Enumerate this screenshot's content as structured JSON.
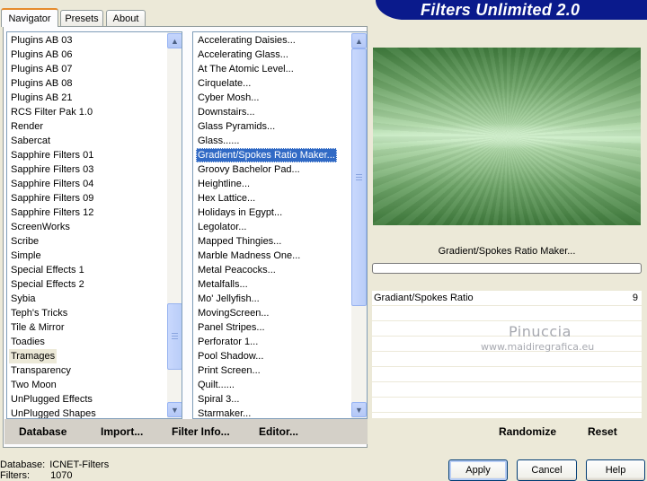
{
  "app": {
    "title": "Filters Unlimited 2.0"
  },
  "tabs": [
    {
      "label": "Navigator",
      "active": true
    },
    {
      "label": "Presets",
      "active": false
    },
    {
      "label": "About",
      "active": false
    }
  ],
  "categories": {
    "items": [
      "Plugins AB 03",
      "Plugins AB 06",
      "Plugins AB 07",
      "Plugins AB 08",
      "Plugins AB 21",
      "RCS Filter Pak 1.0",
      "Render",
      "Sabercat",
      "Sapphire Filters 01",
      "Sapphire Filters 03",
      "Sapphire Filters 04",
      "Sapphire Filters 09",
      "Sapphire Filters 12",
      "ScreenWorks",
      "Scribe",
      "Simple",
      "Special Effects 1",
      "Special Effects 2",
      "Sybia",
      "Teph's Tricks",
      "Tile & Mirror",
      "Toadies",
      "Tramages",
      "Transparency",
      "Two Moon",
      "UnPlugged Effects",
      "UnPlugged Shapes"
    ],
    "selected": "Tramages"
  },
  "filters": {
    "items": [
      "Accelerating Daisies...",
      "Accelerating Glass...",
      "At The Atomic Level...",
      "Cirquelate...",
      "Cyber Mosh...",
      "Downstairs...",
      "Glass Pyramids...",
      "Glass......",
      "Gradient/Spokes Ratio Maker...",
      "Groovy Bachelor Pad...",
      "Heightline...",
      "Hex Lattice...",
      "Holidays in Egypt...",
      "Legolator...",
      "Mapped Thingies...",
      "Marble Madness One...",
      "Metal Peacocks...",
      "Metalfalls...",
      "Mo' Jellyfish...",
      "MovingScreen...",
      "Panel Stripes...",
      "Perforator 1...",
      "Pool Shadow...",
      "Print Screen...",
      "Quilt......",
      "Spiral 3...",
      "Starmaker..."
    ],
    "selected": "Gradient/Spokes Ratio Maker..."
  },
  "left_buttons": {
    "database": "Database",
    "import": "Import...",
    "filter_info": "Filter Info...",
    "editor": "Editor..."
  },
  "preview": {
    "filter_name": "Gradient/Spokes Ratio Maker...",
    "progress": 0,
    "colors": {
      "dark": "#3f7a3c",
      "light": "#c8ebc4"
    }
  },
  "params": [
    {
      "label": "Gradiant/Spokes Ratio",
      "value": "9"
    }
  ],
  "watermark": {
    "name": "Pinuccia",
    "site": "www.maidiregrafica.eu"
  },
  "right_buttons": {
    "randomize": "Randomize",
    "reset": "Reset"
  },
  "status": {
    "database_label": "Database:",
    "database_value": "ICNET-Filters",
    "filters_label": "Filters:",
    "filters_value": "1070"
  },
  "dialog_buttons": {
    "apply": "Apply",
    "cancel": "Cancel",
    "help": "Help"
  },
  "icons": {
    "up": "scroll-up-arrow-icon",
    "down": "scroll-down-arrow-icon"
  }
}
